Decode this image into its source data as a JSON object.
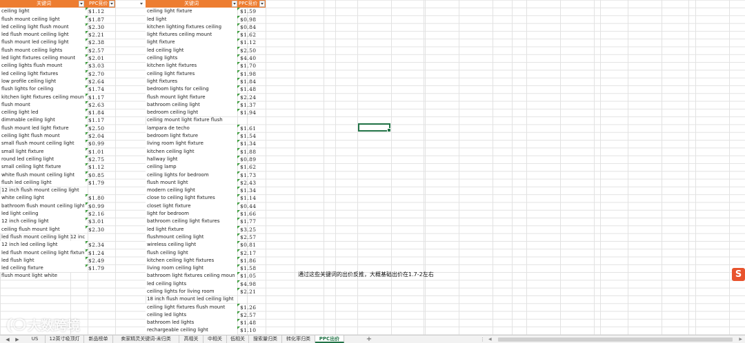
{
  "spreadsheet": {
    "table1": {
      "header_keyword": "关键词",
      "header_ppc": "PPC竞价",
      "rows": [
        {
          "keyword": "ceiling light",
          "ppc": "$1.12"
        },
        {
          "keyword": "flush mount ceiling light",
          "ppc": "$1.87"
        },
        {
          "keyword": "led ceiling light flush mount",
          "ppc": "$2.30"
        },
        {
          "keyword": "led flush mount ceiling light",
          "ppc": "$2.21"
        },
        {
          "keyword": "flush mount led ceiling light",
          "ppc": "$2.38"
        },
        {
          "keyword": "flush mount ceiling lights",
          "ppc": "$2.57"
        },
        {
          "keyword": "led light fixtures ceiling mount",
          "ppc": "$2.01"
        },
        {
          "keyword": "ceiling lights flush mount",
          "ppc": "$3.03"
        },
        {
          "keyword": "led ceiling light fixtures",
          "ppc": "$2.70"
        },
        {
          "keyword": "low profile ceiling light",
          "ppc": "$2.64"
        },
        {
          "keyword": "flush lights for ceiling",
          "ppc": "$1.74"
        },
        {
          "keyword": "kitchen light fixtures ceiling mount",
          "ppc": "$1.17"
        },
        {
          "keyword": "flush mount",
          "ppc": "$2.63"
        },
        {
          "keyword": "ceiling light led",
          "ppc": "$1.84"
        },
        {
          "keyword": "dimmable ceiling light",
          "ppc": "$1.17"
        },
        {
          "keyword": "flush mount led light fixture",
          "ppc": "$2.50"
        },
        {
          "keyword": "ceiling light flush mount",
          "ppc": "$2.04"
        },
        {
          "keyword": "small flush mount ceiling light",
          "ppc": "$0.99"
        },
        {
          "keyword": "small light fixture",
          "ppc": "$1.01"
        },
        {
          "keyword": "round led ceiling light",
          "ppc": "$2.75"
        },
        {
          "keyword": "small ceiling light fixture",
          "ppc": "$1.12"
        },
        {
          "keyword": "white flush mount ceiling light",
          "ppc": "$0.85"
        },
        {
          "keyword": "flush led ceiling light",
          "ppc": "$1.79"
        },
        {
          "keyword": "12 inch flush mount ceiling light",
          "ppc": ""
        },
        {
          "keyword": "white ceiling light",
          "ppc": "$1.80"
        },
        {
          "keyword": "bathroom flush mount ceiling light",
          "ppc": "$0.99"
        },
        {
          "keyword": "led light ceiling",
          "ppc": "$2.16"
        },
        {
          "keyword": "12 inch ceiling light",
          "ppc": "$3.01"
        },
        {
          "keyword": "ceiling flush mount light",
          "ppc": "$2.30"
        },
        {
          "keyword": "led flush mount ceiling light 12 inc",
          "ppc": ""
        },
        {
          "keyword": "12 inch led ceiling light",
          "ppc": "$2.34"
        },
        {
          "keyword": "led flush mount ceiling light fixture",
          "ppc": "$1.24"
        },
        {
          "keyword": "led flush light",
          "ppc": "$2.49"
        },
        {
          "keyword": "led ceiling fixture",
          "ppc": "$1.79"
        },
        {
          "keyword": "flush mount light white",
          "ppc": ""
        }
      ]
    },
    "table2": {
      "header_keyword": "关键词",
      "header_ppc": "PPC竞价",
      "rows": [
        {
          "keyword": "ceiling light fixture",
          "ppc": "$1.59"
        },
        {
          "keyword": "led light",
          "ppc": "$0.98"
        },
        {
          "keyword": "kitchen lighting fixtures ceiling",
          "ppc": "$0.84"
        },
        {
          "keyword": "light fixtures ceiling mount",
          "ppc": "$1.62"
        },
        {
          "keyword": "light fixture",
          "ppc": "$1.12"
        },
        {
          "keyword": "led ceiling light",
          "ppc": "$2.50"
        },
        {
          "keyword": "ceiling lights",
          "ppc": "$4.40"
        },
        {
          "keyword": "kitchen light fixtures",
          "ppc": "$1.70"
        },
        {
          "keyword": "ceiling light fixtures",
          "ppc": "$1.98"
        },
        {
          "keyword": "light fixtures",
          "ppc": "$1.84"
        },
        {
          "keyword": "bedroom lights for ceiling",
          "ppc": "$1.48"
        },
        {
          "keyword": "flush mount light fixture",
          "ppc": "$2.24"
        },
        {
          "keyword": "bathroom ceiling light",
          "ppc": "$1.37"
        },
        {
          "keyword": "bedroom ceiling light",
          "ppc": "$1.94"
        },
        {
          "keyword": "ceiling mount light fixture flush",
          "ppc": ""
        },
        {
          "keyword": "lampara de techo",
          "ppc": "$1.61"
        },
        {
          "keyword": "bedroom light fixture",
          "ppc": "$1.54"
        },
        {
          "keyword": "living room light fixture",
          "ppc": "$1.34"
        },
        {
          "keyword": "kitchen ceiling light",
          "ppc": "$1.88"
        },
        {
          "keyword": "hallway light",
          "ppc": "$0.89"
        },
        {
          "keyword": "ceiling lamp",
          "ppc": "$1.62"
        },
        {
          "keyword": "ceiling lights for bedroom",
          "ppc": "$1.73"
        },
        {
          "keyword": "flush mount light",
          "ppc": "$2.43"
        },
        {
          "keyword": "modern ceiling light",
          "ppc": "$1.34"
        },
        {
          "keyword": "close to ceiling light fixtures",
          "ppc": "$1.14"
        },
        {
          "keyword": "closet light fixture",
          "ppc": "$0.44"
        },
        {
          "keyword": "light for bedroom",
          "ppc": "$1.66"
        },
        {
          "keyword": "bathroom ceiling light fixtures",
          "ppc": "$1.77"
        },
        {
          "keyword": "led light fixture",
          "ppc": "$3.25"
        },
        {
          "keyword": "flushmount ceiling light",
          "ppc": "$2.57"
        },
        {
          "keyword": "wireless ceiling light",
          "ppc": "$0.81"
        },
        {
          "keyword": "flush ceiling light",
          "ppc": "$2.17"
        },
        {
          "keyword": "kitchen ceiling light fixtures",
          "ppc": "$1.86"
        },
        {
          "keyword": "living room ceiling light",
          "ppc": "$1.58"
        },
        {
          "keyword": "bathroom light fixtures ceiling moun",
          "ppc": "$1.05"
        },
        {
          "keyword": "led ceiling lights",
          "ppc": "$4.98"
        },
        {
          "keyword": "ceiling lights for living room",
          "ppc": "$2.21"
        },
        {
          "keyword": "18 inch flush mount led ceiling light",
          "ppc": ""
        },
        {
          "keyword": "ceiling light fixtures flush mount",
          "ppc": "$1.26"
        },
        {
          "keyword": "ceiling led lights",
          "ppc": "$2.57"
        },
        {
          "keyword": "bathroom led lights",
          "ppc": "$1.48"
        },
        {
          "keyword": "rechargeable ceiling light",
          "ppc": "$1.10"
        }
      ]
    },
    "note": "通过这些关键词的出价反推，大概基础出价在1.7-2左右",
    "logo_glyph": "S",
    "watermark": {
      "mark": "(❍",
      "text": "大数跨境"
    }
  },
  "tabs": {
    "nav_prev": "◀",
    "nav_next": "▶",
    "items": [
      {
        "label": "US",
        "active": false
      },
      {
        "label": "12英寸吸顶灯",
        "active": false
      },
      {
        "label": "新品榜单",
        "active": false
      },
      {
        "label": "卖家精灵关键词-未归类",
        "active": false
      },
      {
        "label": "高相关",
        "active": false
      },
      {
        "label": "中相关",
        "active": false
      },
      {
        "label": "低相关",
        "active": false
      },
      {
        "label": "搜索量归类",
        "active": false
      },
      {
        "label": "转化率归类",
        "active": false
      },
      {
        "label": "PPC出价",
        "active": true
      }
    ],
    "add_label": "+"
  },
  "scrollbar": {
    "dots": "⋮",
    "left_arrow": "◀",
    "right_arrow": "▶"
  },
  "colors": {
    "header_bg": "#ed7d31",
    "selection": "#217346",
    "comment_marker": "#3a9a3a",
    "logo": "#e8532d"
  }
}
